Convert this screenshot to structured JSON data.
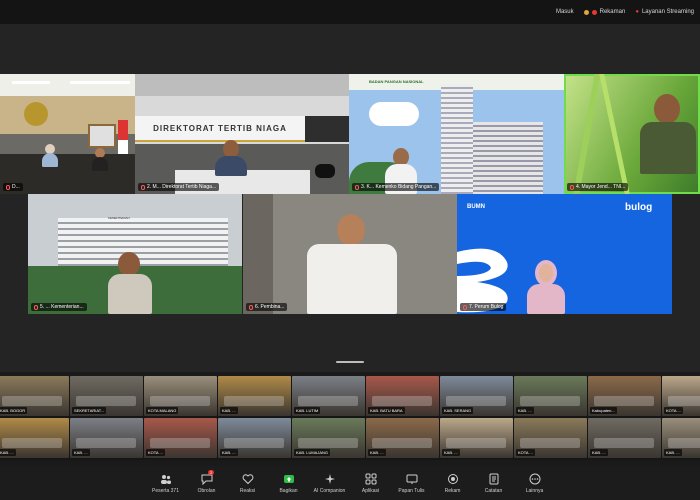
{
  "topbar": {
    "items": [
      {
        "label": "Masuk",
        "icon": "sign-in-icon"
      },
      {
        "label": "Rekaman",
        "icon": "record-icon",
        "color": "#e53935"
      },
      {
        "label": "Layanan Streaming",
        "icon": "streaming-icon"
      }
    ]
  },
  "colors": {
    "active_speaker": "#6fdc4a",
    "accent_green": "#2fbd4a",
    "bulog_blue": "#1565e0"
  },
  "main_tiles": [
    {
      "name": "Ruang Rapat",
      "label": "D..."
    },
    {
      "name": "Direktorat Tertib Niaga",
      "label": "2. M... Direktorat Tertib Niaga...",
      "banner": "DIREKTORAT TERTIB NIAGA"
    },
    {
      "name": "Gedung Bertingkat",
      "label": "3. K... Kemenko Bidang Pangan...",
      "banner": "BADAN PANGAN NASIONAL"
    },
    {
      "name": "Tentara di Sawah",
      "label": "4. Mayor Jend... TNI..."
    },
    {
      "name": "Gedung Kementerian",
      "label": "5. ... Kementerian...",
      "caption": "KEMENTERIAN"
    },
    {
      "name": "Ruang Kerja",
      "label": "6. Pembina..."
    },
    {
      "name": "Bulog",
      "label": "7. Perum Bulog",
      "bumn_text": "BUMN",
      "bulog_text": "bulog"
    }
  ],
  "thumbnails": [
    {
      "label": "KAB. BOGOR"
    },
    {
      "label": "SEKRETARIAT..."
    },
    {
      "label": "KOTA MALANG"
    },
    {
      "label": "KAB. ..."
    },
    {
      "label": "KAB. LUTIM"
    },
    {
      "label": "KAB. BATU BARA"
    },
    {
      "label": "KAB. SERANG"
    },
    {
      "label": "KAB. ..."
    },
    {
      "label": "Kabupaten..."
    },
    {
      "label": "KOTA ..."
    },
    {
      "label": "KAB. ..."
    },
    {
      "label": "KAB. ..."
    },
    {
      "label": "KOTA ..."
    },
    {
      "label": "KAB. ..."
    },
    {
      "label": "KAB. LUMAJANG"
    },
    {
      "label": "KAB. ..."
    },
    {
      "label": "KAB. ..."
    },
    {
      "label": "KOTA ..."
    },
    {
      "label": "KAB. ..."
    },
    {
      "label": "KAB. ..."
    }
  ],
  "toolbar": {
    "items": [
      {
        "label": "Peserta",
        "icon": "participants-icon",
        "count": "371"
      },
      {
        "label": "Obrolan",
        "icon": "chat-icon",
        "badge": "2"
      },
      {
        "label": "Reaksi",
        "icon": "reaction-icon"
      },
      {
        "label": "Bagikan",
        "icon": "share-icon"
      },
      {
        "label": "AI Companion",
        "icon": "ai-companion-icon"
      },
      {
        "label": "Aplikasi",
        "icon": "apps-icon"
      },
      {
        "label": "Papan Tulis",
        "icon": "whiteboard-icon"
      },
      {
        "label": "Rekam",
        "icon": "record-icon"
      },
      {
        "label": "Catatan",
        "icon": "notes-icon"
      },
      {
        "label": "Lainnya",
        "icon": "more-icon"
      }
    ]
  }
}
